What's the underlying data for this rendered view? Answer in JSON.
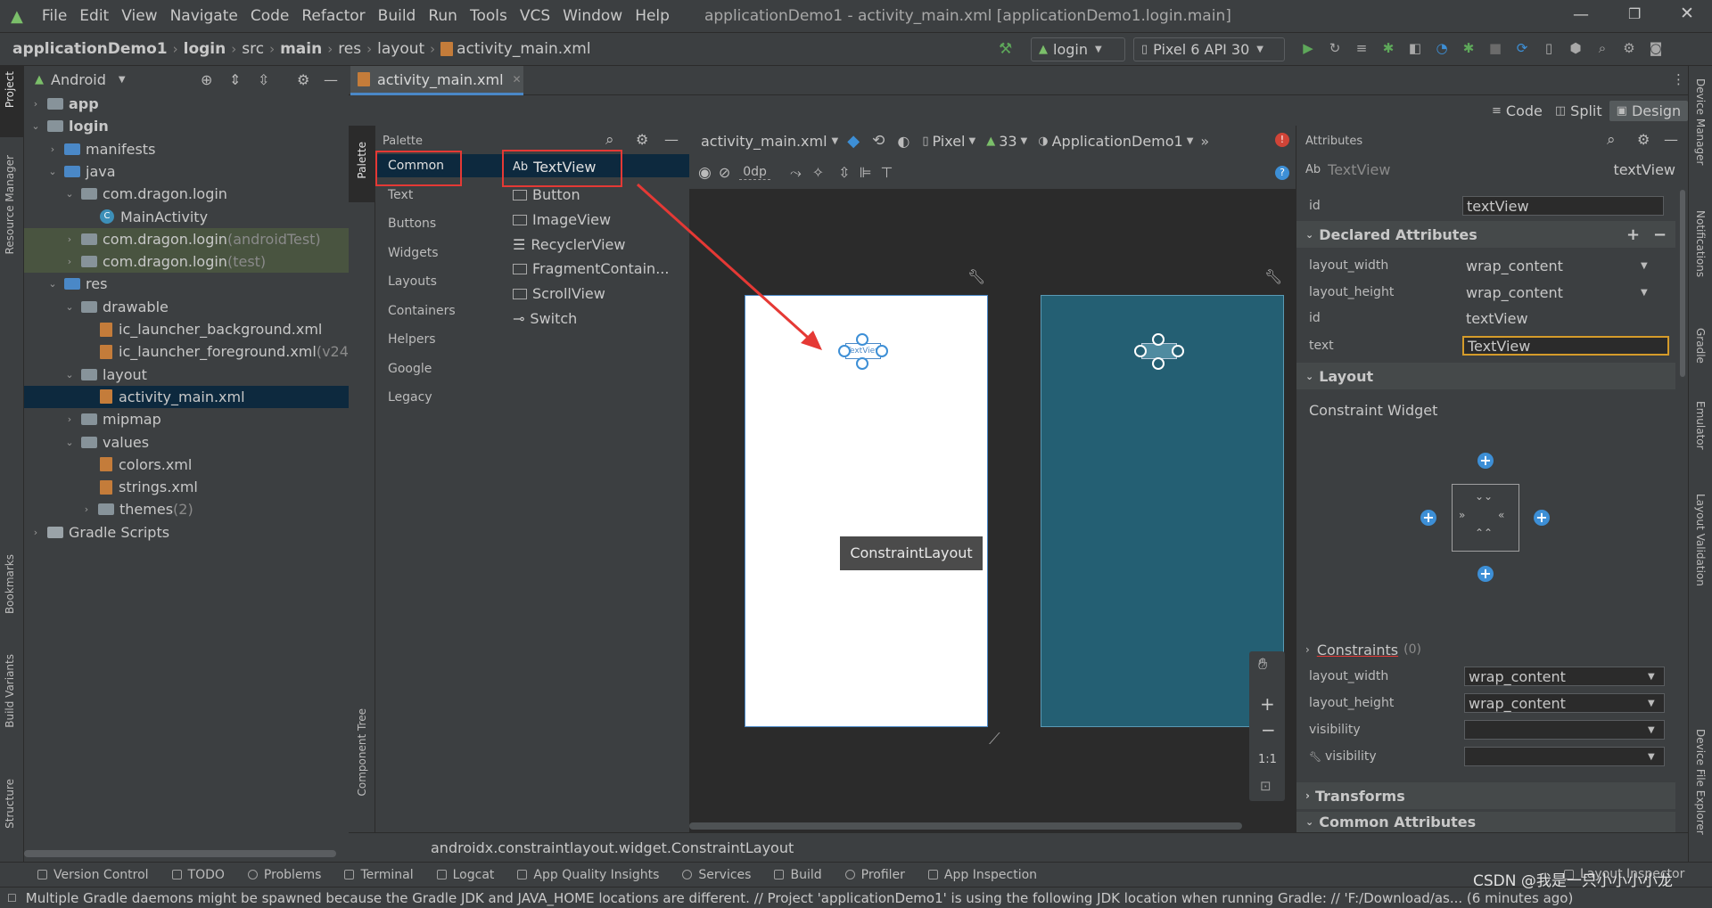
{
  "menubar": {
    "items": [
      "File",
      "Edit",
      "View",
      "Navigate",
      "Code",
      "Refactor",
      "Build",
      "Run",
      "Tools",
      "VCS",
      "Window",
      "Help"
    ],
    "title": "applicationDemo1 - activity_main.xml [applicationDemo1.login.main]"
  },
  "navbar": {
    "crumbs": [
      "applicationDemo1",
      "login",
      "src",
      "main",
      "res",
      "layout",
      "activity_main.xml"
    ],
    "run_config": "login",
    "device": "Pixel 6 API 30"
  },
  "left_strip": {
    "project": "Project",
    "resource_manager": "Resource Manager",
    "bookmarks": "Bookmarks",
    "build_variants": "Build Variants",
    "structure": "Structure"
  },
  "right_strip": {
    "device_manager": "Device Manager",
    "notifications": "Notifications",
    "gradle": "Gradle",
    "emulator": "Emulator",
    "layout_validation": "Layout Validation",
    "device_file_explorer": "Device File Explorer"
  },
  "project": {
    "view_label": "Android",
    "tree": [
      {
        "label": "app",
        "suffix": ""
      },
      {
        "label": "login",
        "suffix": ""
      },
      {
        "label": "manifests",
        "suffix": ""
      },
      {
        "label": "java",
        "suffix": ""
      },
      {
        "label": "com.dragon.login",
        "suffix": ""
      },
      {
        "label": "MainActivity",
        "suffix": ""
      },
      {
        "label": "com.dragon.login",
        "suffix": " (androidTest)"
      },
      {
        "label": "com.dragon.login",
        "suffix": " (test)"
      },
      {
        "label": "res",
        "suffix": ""
      },
      {
        "label": "drawable",
        "suffix": ""
      },
      {
        "label": "ic_launcher_background.xml",
        "suffix": ""
      },
      {
        "label": "ic_launcher_foreground.xml",
        "suffix": " (v24"
      },
      {
        "label": "layout",
        "suffix": ""
      },
      {
        "label": "activity_main.xml",
        "suffix": ""
      },
      {
        "label": "mipmap",
        "suffix": ""
      },
      {
        "label": "values",
        "suffix": ""
      },
      {
        "label": "colors.xml",
        "suffix": ""
      },
      {
        "label": "strings.xml",
        "suffix": ""
      },
      {
        "label": "themes",
        "suffix": " (2)"
      },
      {
        "label": "Gradle Scripts",
        "suffix": ""
      }
    ]
  },
  "editor": {
    "tab": "activity_main.xml",
    "view_modes": [
      "Code",
      "Split",
      "Design"
    ]
  },
  "palette": {
    "title": "Palette",
    "strip_palette": "Palette",
    "strip_tree": "Component Tree",
    "categories": [
      "Common",
      "Text",
      "Buttons",
      "Widgets",
      "Layouts",
      "Containers",
      "Helpers",
      "Google",
      "Legacy"
    ],
    "items": [
      "TextView",
      "Button",
      "ImageView",
      "RecyclerView",
      "FragmentContain...",
      "ScrollView",
      "Switch"
    ],
    "textview_prefix": "Ab"
  },
  "design_toolbar": {
    "file": "activity_main.xml",
    "device": "Pixel",
    "api": "33",
    "theme": "ApplicationDemo1",
    "margin": "0dp"
  },
  "canvas": {
    "tooltip": "ConstraintLayout",
    "zoom_reset": "1:1",
    "widget_text": "TextView"
  },
  "attributes": {
    "title": "Attributes",
    "widget_prefix": "Ab",
    "widget_name": "TextView",
    "widget_id": "textView",
    "id_label": "id",
    "id_value": "textView",
    "declared_title": "Declared Attributes",
    "declared": [
      {
        "name": "layout_width",
        "value": "wrap_content"
      },
      {
        "name": "layout_height",
        "value": "wrap_content"
      },
      {
        "name": "id",
        "value": "textView"
      },
      {
        "name": "text",
        "value": "TextView"
      }
    ],
    "layout_title": "Layout",
    "constraint_widget": "Constraint Widget",
    "constraints_label": "Constraints",
    "constraints_count": "(0)",
    "layout_rows": [
      {
        "name": "layout_width",
        "value": "wrap_content"
      },
      {
        "name": "layout_height",
        "value": "wrap_content"
      },
      {
        "name": "visibility",
        "value": ""
      },
      {
        "name": "visibility",
        "value": ""
      }
    ],
    "transforms_title": "Transforms",
    "common_title": "Common Attributes"
  },
  "statusline": {
    "class_path": "androidx.constraintlayout.widget.ConstraintLayout"
  },
  "bottom_tabs": [
    "Version Control",
    "TODO",
    "Problems",
    "Terminal",
    "Logcat",
    "App Quality Insights",
    "Services",
    "Build",
    "Profiler",
    "App Inspection"
  ],
  "layout_inspector": "Layout Inspector",
  "message": "Multiple Gradle daemons might be spawned because the Gradle JDK and JAVA_HOME locations are different. // Project 'applicationDemo1' is using the following JDK location when running Gradle: // 'F:/Download/as... (6 minutes ago)",
  "watermark": "CSDN @我是一只小小小小龙",
  "colors": {
    "accent": "#3d8fd6",
    "blueprint": "#245f73",
    "highlight_red": "#e53935",
    "selection": "#0d293e"
  }
}
